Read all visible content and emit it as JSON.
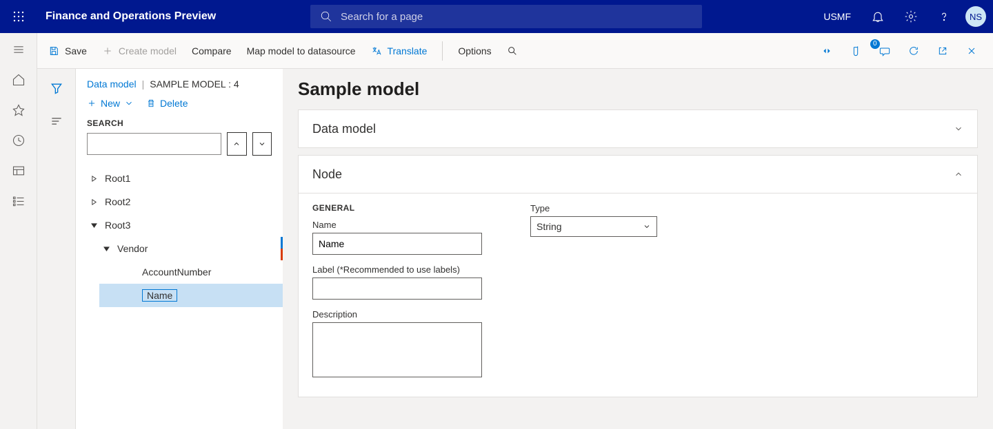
{
  "header": {
    "app_title": "Finance and Operations Preview",
    "search_placeholder": "Search for a page",
    "org": "USMF",
    "avatar_initials": "NS"
  },
  "commandbar": {
    "save": "Save",
    "create_model": "Create model",
    "compare": "Compare",
    "map_model": "Map model to datasource",
    "translate": "Translate",
    "options": "Options",
    "attachment_badge": "0"
  },
  "breadcrumb": {
    "page": "Data model",
    "detail": "SAMPLE MODEL : 4"
  },
  "tree_toolbar": {
    "new_label": "New",
    "delete_label": "Delete"
  },
  "search_section": {
    "label": "SEARCH"
  },
  "tree": {
    "r0": "Root1",
    "r1": "Root2",
    "r2": "Root3",
    "vendor": "Vendor",
    "accountnumber": "AccountNumber",
    "name": "Name"
  },
  "detail": {
    "page_title": "Sample model",
    "section_datamodel": "Data model",
    "section_node": "Node",
    "group_general": "GENERAL",
    "field_name_label": "Name",
    "field_name_value": "Name",
    "field_label_label": "Label (*Recommended to use labels)",
    "field_label_value": "",
    "field_description_label": "Description",
    "field_type_label": "Type",
    "field_type_value": "String"
  }
}
